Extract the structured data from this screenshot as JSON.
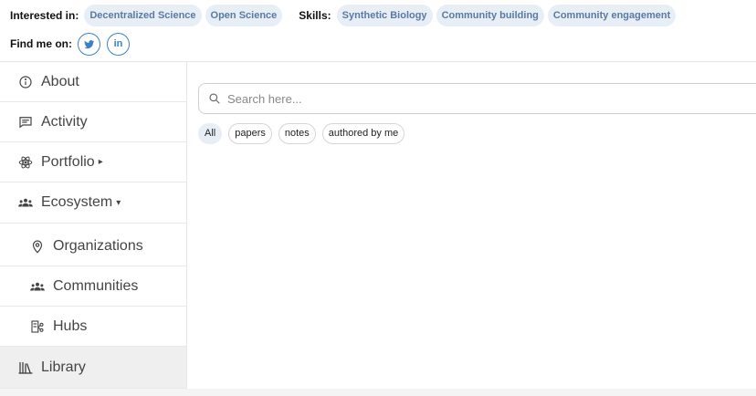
{
  "profile": {
    "interested_label": "Interested in:",
    "interests": [
      "Decentralized Science",
      "Open Science"
    ],
    "skills_label": "Skills:",
    "skills": [
      "Synthetic Biology",
      "Community building",
      "Community engagement"
    ],
    "find_me_label": "Find me on:",
    "social": [
      {
        "name": "twitter",
        "icon": "twitter-icon"
      },
      {
        "name": "linkedin",
        "icon": "linkedin-icon",
        "text": "in"
      }
    ]
  },
  "sidebar": {
    "items": [
      {
        "label": "About",
        "icon": "info-icon"
      },
      {
        "label": "Activity",
        "icon": "comment-icon"
      },
      {
        "label": "Portfolio",
        "icon": "atom-icon",
        "caret": "▸"
      },
      {
        "label": "Ecosystem",
        "icon": "people-icon",
        "caret": "▾"
      },
      {
        "label": "Organizations",
        "icon": "location-pin-icon"
      },
      {
        "label": "Communities",
        "icon": "people-icon"
      },
      {
        "label": "Hubs",
        "icon": "hub-icon"
      },
      {
        "label": "Library",
        "icon": "library-icon",
        "active": true
      }
    ]
  },
  "main": {
    "search": {
      "placeholder": "Search here..."
    },
    "filters": [
      "All",
      "papers",
      "notes",
      "authored by me"
    ],
    "selected_filter": "All"
  },
  "colors": {
    "chip_bg": "#e8eef6",
    "chip_text": "#5b7aa0",
    "social_blue": "#3b82c4",
    "active_bg": "#efefef"
  }
}
